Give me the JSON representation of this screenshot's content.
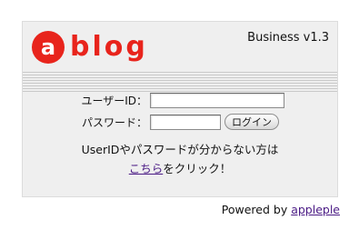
{
  "header": {
    "logo_mark": "a",
    "logo_text": "blog",
    "edition": "Business v1.3"
  },
  "login_form": {
    "user_label": "ユーザーID：",
    "user_value": "",
    "password_label": "パスワード：",
    "password_value": "",
    "login_button": "ログイン"
  },
  "help": {
    "line1": "UserIDやパスワードが分からない方は",
    "link_text": "こちら",
    "line2_suffix": "をクリック！"
  },
  "footer": {
    "powered_by": "Powered by",
    "link_text": "appleple"
  },
  "colors": {
    "brand": "#e8241c",
    "panel_bg": "#efefef",
    "link": "#4b1b85"
  }
}
